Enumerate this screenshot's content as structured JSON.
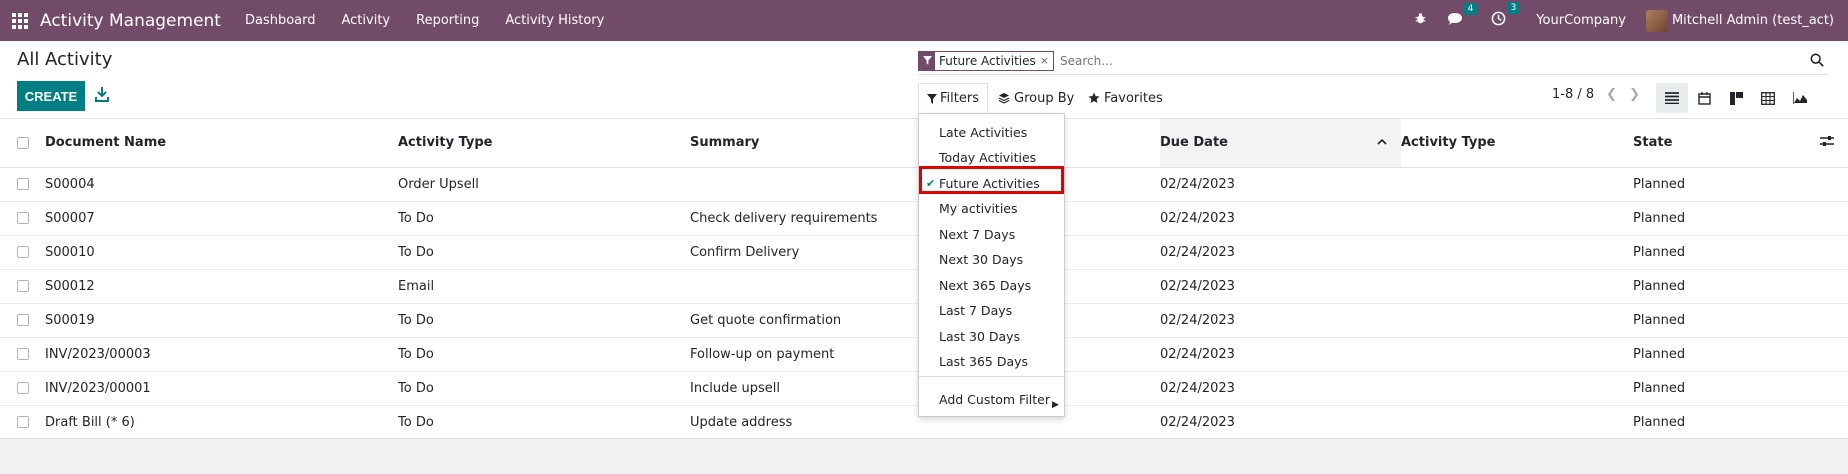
{
  "navbar": {
    "app_title": "Activity Management",
    "menu": [
      "Dashboard",
      "Activity",
      "Reporting",
      "Activity History"
    ],
    "messages_count": "4",
    "activities_count": "3",
    "company": "YourCompany",
    "user": "Mitchell Admin (test_act)"
  },
  "control": {
    "title": "All Activity",
    "create_label": "CREATE",
    "facet_label": "Future Activities",
    "facet_remove": "×",
    "search_placeholder": "Search...",
    "filters_label": "Filters",
    "groupby_label": "Group By",
    "favorites_label": "Favorites",
    "pager": "1-8 / 8"
  },
  "table": {
    "columns": [
      "Document Name",
      "Activity Type",
      "Summary",
      "Due Date",
      "Activity Type",
      "State"
    ],
    "rows": [
      {
        "doc": "S00004",
        "type": "Order Upsell",
        "summary": "",
        "due": "02/24/2023",
        "type2": "",
        "state": "Planned"
      },
      {
        "doc": "S00007",
        "type": "To Do",
        "summary": "Check delivery requirements",
        "due": "02/24/2023",
        "type2": "",
        "state": "Planned"
      },
      {
        "doc": "S00010",
        "type": "To Do",
        "summary": "Confirm Delivery",
        "due": "02/24/2023",
        "type2": "",
        "state": "Planned"
      },
      {
        "doc": "S00012",
        "type": "Email",
        "summary": "",
        "due": "02/24/2023",
        "type2": "",
        "state": "Planned"
      },
      {
        "doc": "S00019",
        "type": "To Do",
        "summary": "Get quote confirmation",
        "due": "02/24/2023",
        "type2": "",
        "state": "Planned"
      },
      {
        "doc": "INV/2023/00003",
        "type": "To Do",
        "summary": "Follow-up on payment",
        "due": "02/24/2023",
        "type2": "",
        "state": "Planned"
      },
      {
        "doc": "INV/2023/00001",
        "type": "To Do",
        "summary": "Include upsell",
        "due": "02/24/2023",
        "type2": "",
        "state": "Planned"
      },
      {
        "doc": "Draft Bill (* 6)",
        "type": "To Do",
        "summary": "Update address",
        "due": "02/24/2023",
        "type2": "",
        "state": "Planned"
      }
    ]
  },
  "filters_menu": {
    "items": [
      "Late Activities",
      "Today Activities",
      "Future Activities",
      "My activities",
      "Next 7 Days",
      "Next 30 Days",
      "Next 365 Days",
      "Last 7 Days",
      "Last 30 Days",
      "Last 365 Days"
    ],
    "selected": "Future Activities",
    "custom": "Add Custom Filter"
  },
  "colors": {
    "brand": "#714b67",
    "accent": "#017e84",
    "highlight": "#e00000"
  }
}
